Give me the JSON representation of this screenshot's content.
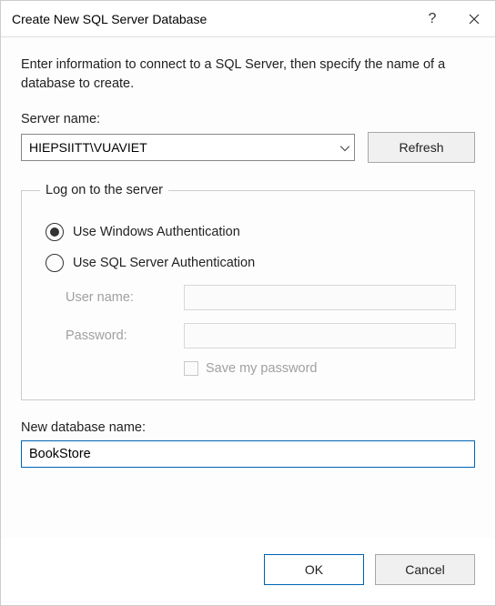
{
  "titlebar": {
    "title": "Create New SQL Server Database"
  },
  "description": "Enter information to connect to a SQL Server, then specify the name of a database to create.",
  "server": {
    "label": "Server name:",
    "value": "HIEPSIITT\\VUAVIET",
    "refresh_label": "Refresh"
  },
  "logon": {
    "legend": "Log on to the server",
    "windows_auth": "Use Windows Authentication",
    "sql_auth": "Use SQL Server Authentication",
    "auth_selected": "windows",
    "username_label": "User name:",
    "username_value": "",
    "password_label": "Password:",
    "password_value": "",
    "save_password_label": "Save my password",
    "save_password_checked": false
  },
  "newdb": {
    "label": "New database name:",
    "value": "BookStore"
  },
  "buttons": {
    "ok": "OK",
    "cancel": "Cancel"
  }
}
